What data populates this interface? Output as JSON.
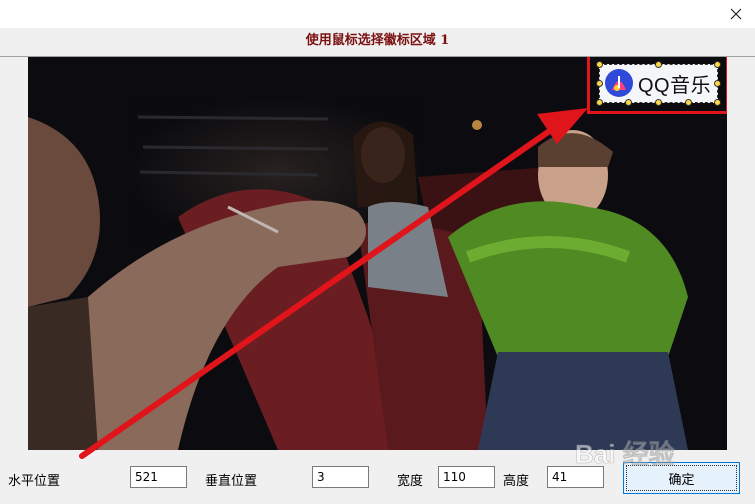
{
  "window": {
    "dialog_title": "使用鼠标选择徽标区域 1"
  },
  "logo": {
    "brand_text": "QQ音乐"
  },
  "fields": {
    "horizontal_label": "水平位置",
    "horizontal_value": "521",
    "vertical_label": "垂直位置",
    "vertical_value": "3",
    "width_label": "宽度",
    "width_value": "110",
    "height_label": "高度",
    "height_value": "41"
  },
  "buttons": {
    "ok_label": "确定"
  },
  "colors": {
    "annotation_red": "#e0141b",
    "title_red": "#7a1010"
  },
  "icons": {
    "close": "close-icon",
    "music": "qq-music-icon"
  },
  "watermark": {
    "text": "Bai 经验"
  }
}
